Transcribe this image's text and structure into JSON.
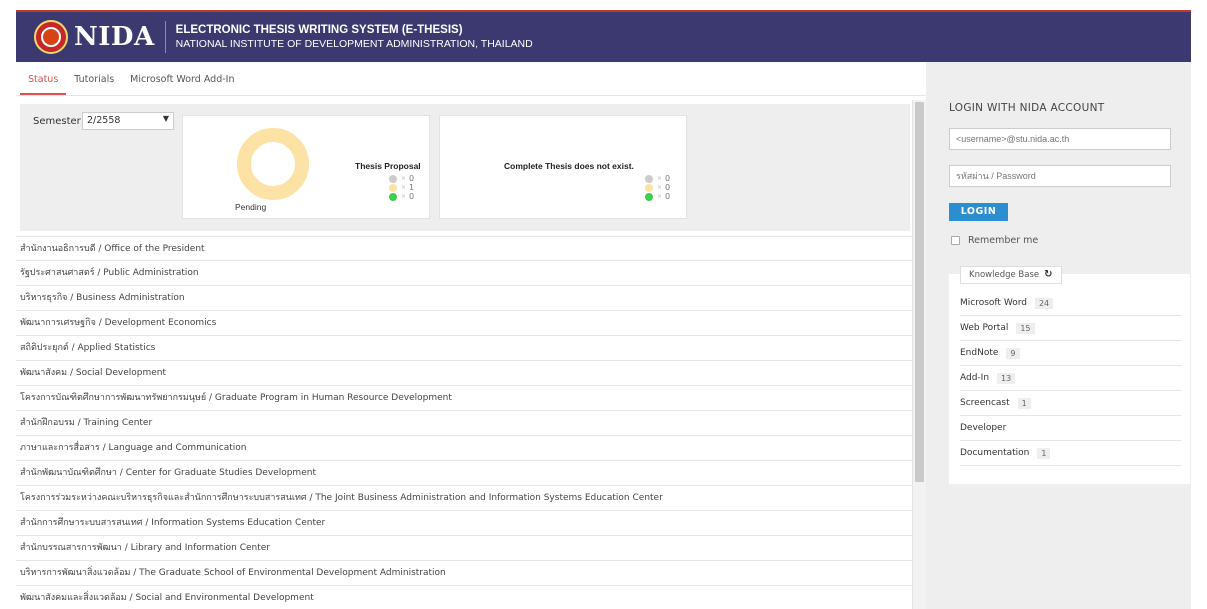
{
  "header": {
    "logo_text": "NIDA",
    "title": "ELECTRONIC THESIS WRITING SYSTEM (E-THESIS)",
    "subtitle": "NATIONAL INSTITUTE OF DEVELOPMENT ADMINISTRATION, THAILAND"
  },
  "tabs": [
    {
      "label": "Status",
      "active": true
    },
    {
      "label": "Tutorials",
      "active": false
    },
    {
      "label": "Microsoft Word Add-In",
      "active": false
    }
  ],
  "status": {
    "semester_label": "Semester",
    "semester_value": "2/2558",
    "caret": "▼",
    "thesis_proposal": {
      "title": "Thesis Proposal",
      "donut_label": "Pending",
      "legend": [
        {
          "color": "gray",
          "x": "×",
          "count": "0"
        },
        {
          "color": "yellow",
          "x": "×",
          "count": "1"
        },
        {
          "color": "green",
          "x": "×",
          "count": "0"
        }
      ]
    },
    "complete_thesis": {
      "title": "Complete Thesis does not exist.",
      "legend": [
        {
          "color": "gray",
          "x": "×",
          "count": "0"
        },
        {
          "color": "yellow",
          "x": "×",
          "count": "0"
        },
        {
          "color": "green",
          "x": "×",
          "count": "0"
        }
      ]
    }
  },
  "departments": [
    "สำนักงานอธิการบดี / Office of the President",
    "รัฐประศาสนศาสตร์ / Public Administration",
    "บริหารธุรกิจ / Business Administration",
    "พัฒนาการเศรษฐกิจ / Development Economics",
    "สถิติประยุกต์ / Applied Statistics",
    "พัฒนาสังคม / Social Development",
    "โครงการบัณฑิตศึกษาการพัฒนาทรัพยากรมนุษย์ / Graduate Program in Human Resource Development",
    "สำนักฝึกอบรม / Training Center",
    "ภาษาและการสื่อสาร / Language and Communication",
    "สำนักพัฒนาบัณฑิตศึกษา / Center for Graduate Studies Development",
    "โครงการร่วมระหว่างคณะบริหารธุรกิจและสำนักการศึกษาระบบสารสนเทศ / The Joint Business Administration and Information Systems Education Center",
    "สำนักการศึกษาระบบสารสนเทศ / Information Systems Education Center",
    "สำนักบรรณสารการพัฒนา / Library and Information Center",
    "บริหารการพัฒนาสิ่งแวดล้อม / The Graduate School of Environmental Development Administration",
    "พัฒนาสังคมและสิ่งแวดล้อม / Social and Environmental Development"
  ],
  "login": {
    "title": "LOGIN WITH NIDA ACCOUNT",
    "username_placeholder": "<username>@stu.nida.ac.th",
    "password_placeholder": "รหัสผ่าน / Password",
    "button": "LOGIN",
    "remember": "Remember me"
  },
  "knowledge_base": {
    "title": "Knowledge Base",
    "refresh_icon": "↻",
    "items": [
      {
        "label": "Microsoft Word",
        "count": "24"
      },
      {
        "label": "Web Portal",
        "count": "15"
      },
      {
        "label": "EndNote",
        "count": "9"
      },
      {
        "label": "Add-In",
        "count": "13"
      },
      {
        "label": "Screencast",
        "count": "1"
      },
      {
        "label": "Developer",
        "count": ""
      },
      {
        "label": "Documentation",
        "count": "1"
      }
    ]
  },
  "colors": {
    "header_bg": "#3b3970",
    "accent_red": "#d9534f",
    "login_blue": "#2b8fcf",
    "pending_yellow": "#fde2a5",
    "approved_green": "#3ecf4a"
  }
}
